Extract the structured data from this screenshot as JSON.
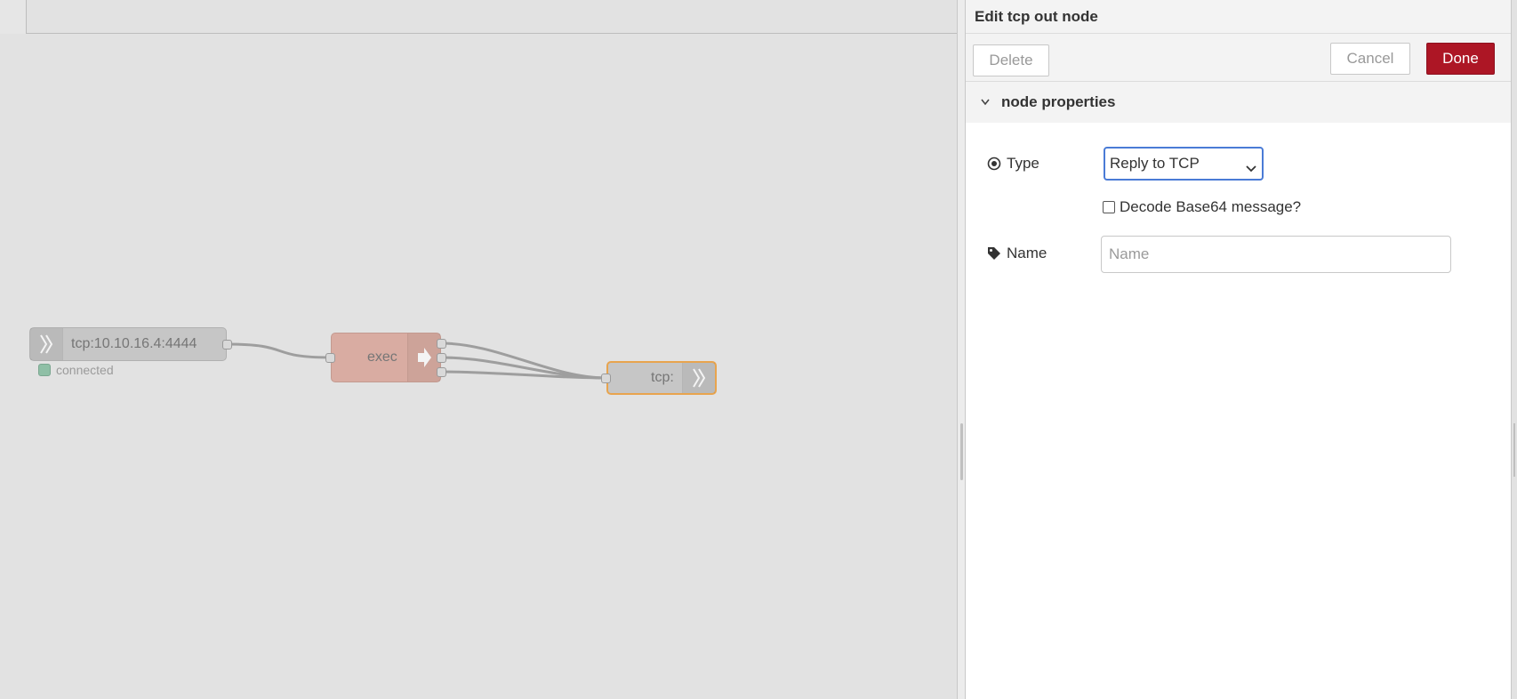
{
  "workspace": {
    "nodes": {
      "tcp_in": {
        "label": "tcp:10.10.16.4:4444",
        "status_text": "connected",
        "status_color": "#8fbfa6"
      },
      "exec": {
        "label": "exec"
      },
      "tcp_out": {
        "label": "tcp:"
      }
    },
    "colors": {
      "selected_outline": "#e8a44e",
      "exec_fill": "#d9aca2"
    }
  },
  "tray": {
    "title": "Edit tcp out node",
    "buttons": {
      "delete": "Delete",
      "cancel": "Cancel",
      "done": "Done"
    },
    "section_title": "node properties",
    "fields": {
      "type_label": "Type",
      "type_value": "Reply to TCP",
      "type_options": [
        "Reply to TCP"
      ],
      "decode_label": "Decode Base64 message?",
      "decode_checked": false,
      "name_label": "Name",
      "name_value": "",
      "name_placeholder": "Name"
    },
    "colors": {
      "done_button": "#ad1625",
      "focus_border": "#4a7bd6"
    }
  }
}
